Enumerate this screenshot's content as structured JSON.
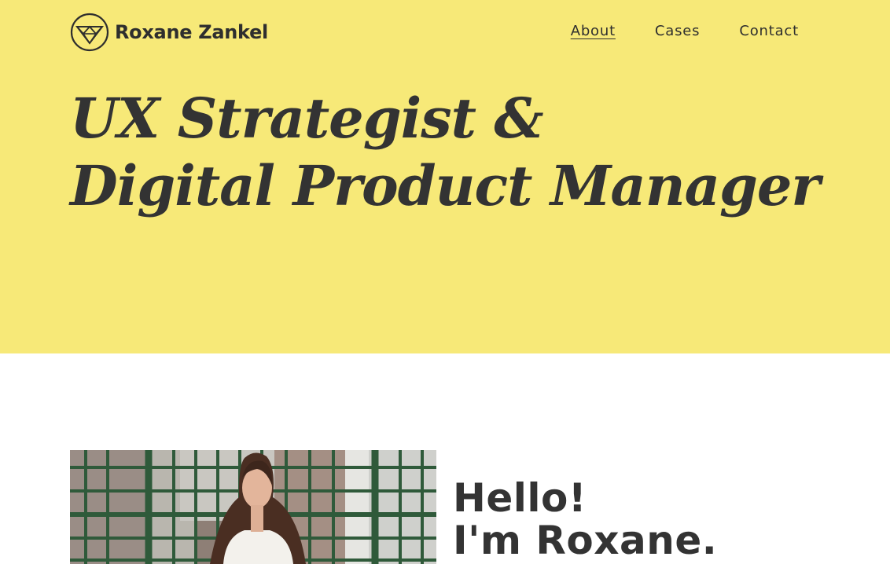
{
  "site": {
    "name": "Roxane Zankel",
    "logo_icon": "diamond-fox-circle-icon"
  },
  "nav": {
    "items": [
      {
        "label": "About",
        "active": true
      },
      {
        "label": "Cases",
        "active": false
      },
      {
        "label": "Contact",
        "active": false
      }
    ]
  },
  "hero": {
    "headline_line1": "UX Strategist &",
    "headline_line2": "Digital Product Manager",
    "background_color": "#F7E978"
  },
  "about": {
    "greeting_line1": "Hello!",
    "greeting_line2": "I'm Roxane.",
    "photo_subject": "portrait-photo"
  },
  "colors": {
    "text": "#333333",
    "hero_bg": "#F7E978",
    "page_bg": "#FFFFFF"
  }
}
